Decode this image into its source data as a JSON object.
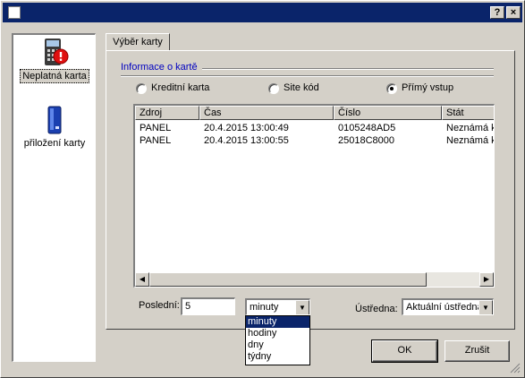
{
  "window": {
    "title": "",
    "help_button": "?",
    "close_button": "×"
  },
  "nav": {
    "items": [
      {
        "label": "Neplatná karta",
        "icon": "card-reader-alert-icon",
        "selected": true
      },
      {
        "label": "přiložení karty",
        "icon": "card-reader-icon",
        "selected": false
      }
    ]
  },
  "tab": {
    "label": "Výběr karty"
  },
  "group": {
    "label": "Informace o kartě"
  },
  "radios": [
    {
      "label": "Kreditní karta",
      "checked": false
    },
    {
      "label": "Site kód",
      "checked": false
    },
    {
      "label": "Přímý vstup",
      "checked": true
    }
  ],
  "table": {
    "columns": [
      "Zdroj",
      "Čas",
      "Číslo",
      "Stát"
    ],
    "rows": [
      [
        "PANEL",
        "20.4.2015 13:00:49",
        "0105248AD5",
        "Neznámá k"
      ],
      [
        "PANEL",
        "20.4.2015 13:00:55",
        "25018C8000",
        "Neznámá k"
      ]
    ]
  },
  "filter": {
    "last_label": "Poslední:",
    "last_value": "5",
    "unit_value": "minuty",
    "unit_options": [
      "minuty",
      "hodiny",
      "dny",
      "týdny"
    ],
    "central_label": "Ústředna:",
    "central_value": "Aktuální ústředna"
  },
  "buttons": {
    "ok": "OK",
    "cancel": "Zrušit"
  },
  "colors": {
    "titlebar": "#0a246a",
    "selection": "#0a246a",
    "group_label": "#0000c0",
    "face": "#d4d0c8"
  }
}
